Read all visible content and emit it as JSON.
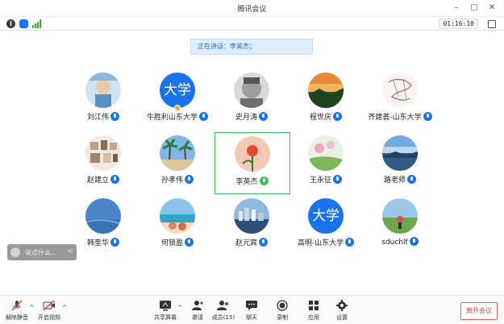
{
  "window": {
    "title": "腾讯会议"
  },
  "status": {
    "timer": "01:16:10",
    "info": "i"
  },
  "banner": {
    "text": "正在讲话：李英杰；"
  },
  "participants": [
    {
      "name": "刘江伟",
      "avatar": "photo-child"
    },
    {
      "name": "牛胜利山东大学",
      "avatar_text": "大学"
    },
    {
      "name": "史月涛",
      "avatar": "photo-grayscale"
    },
    {
      "name": "程世庆",
      "avatar": "photo-sunset"
    },
    {
      "name": "齐建荟-山东大学",
      "avatar": "photo-drawing"
    },
    {
      "name": "赵建立",
      "avatar": "photo-frames"
    },
    {
      "name": "孙孝伟",
      "avatar": "photo-palms"
    },
    {
      "name": "李英杰",
      "avatar": "photo-flower"
    },
    {
      "name": "王永征",
      "avatar": "photo-pink-flowers"
    },
    {
      "name": "路老师",
      "avatar": "photo-sky"
    },
    {
      "name": "韩奎华",
      "avatar": "photo-blue-field"
    },
    {
      "name": "何锁盈",
      "avatar": "photo-beach"
    },
    {
      "name": "赵元宾",
      "avatar": "photo-city"
    },
    {
      "name": "高明-山东大学",
      "avatar_text": "大学"
    },
    {
      "name": "sduchlf",
      "avatar": "photo-meadow"
    }
  ],
  "chat": {
    "placeholder": "说点什么...",
    "collapse": "<"
  },
  "toolbar": {
    "mute": "解除静音",
    "video": "开启视频",
    "share": "共享屏幕",
    "invite": "邀请",
    "members": "成员(15)",
    "chat": "聊天",
    "record": "录制",
    "apps": "应用",
    "settings": "设置",
    "leave": "离开会议",
    "caret": "^"
  },
  "colors": {
    "accent": "#1a73e8",
    "active": "#3cbf5f",
    "leave": "#e04040"
  }
}
